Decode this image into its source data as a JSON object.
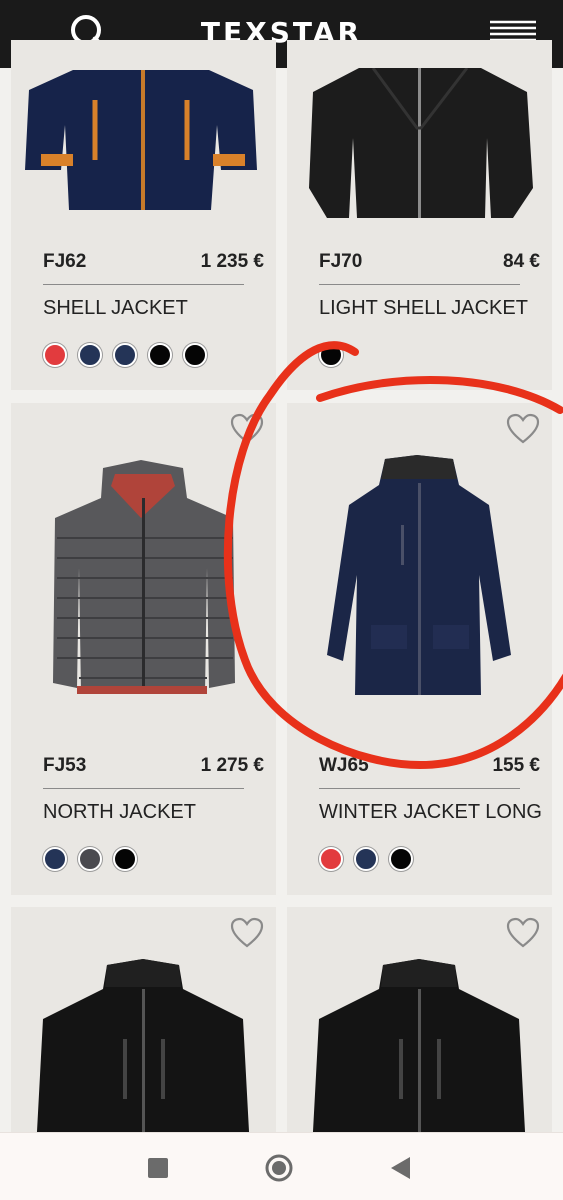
{
  "header": {
    "logo": "TEXSTAR",
    "search_icon": "search-icon",
    "menu_icon": "menu-icon"
  },
  "products": [
    {
      "code": "FJ62",
      "price": "1 235 €",
      "name": "SHELL JACKET",
      "colors": [
        "#e23b3e",
        "#243457",
        "#243457",
        "#050505",
        "#050505"
      ]
    },
    {
      "code": "FJ70",
      "price": "84 €",
      "name": "LIGHT SHELL JACKET",
      "colors": [
        "#050505"
      ]
    },
    {
      "code": "FJ53",
      "price": "1 275 €",
      "name": "NORTH JACKET",
      "colors": [
        "#243457",
        "#4a4a4f",
        "#050505"
      ]
    },
    {
      "code": "WJ65",
      "price": "155 €",
      "name": "WINTER JACKET LONG",
      "colors": [
        "#e23b3e",
        "#243457",
        "#050505"
      ]
    },
    {
      "code": "",
      "price": "",
      "name": "",
      "colors": []
    },
    {
      "code": "",
      "price": "",
      "name": "",
      "colors": []
    }
  ],
  "annotation": {
    "color": "#e8311a"
  },
  "navbar": {
    "icons": [
      "recents-square-icon",
      "home-circle-icon",
      "back-triangle-icon"
    ]
  }
}
